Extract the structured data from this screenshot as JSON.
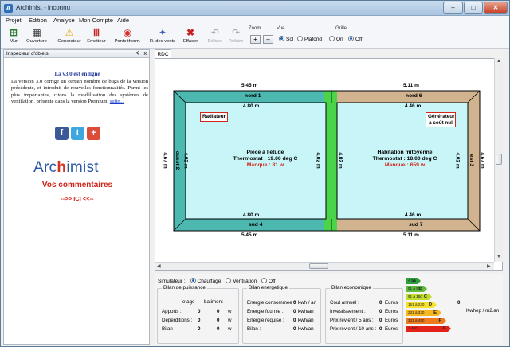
{
  "window": {
    "title": "Archimist - inconnu",
    "controls": {
      "minimize": "–",
      "maximize": "□",
      "close": "✕"
    }
  },
  "menu": [
    "Projet",
    "Edition",
    "Analyse",
    "Mon Compte",
    "Aide"
  ],
  "toolbar": {
    "buttons": [
      {
        "label": "Mur",
        "icon": "plus-wall-icon"
      },
      {
        "label": "Ouverture",
        "icon": "window-icon"
      },
      {
        "label": "Generateur",
        "icon": "warning-triangle-icon"
      },
      {
        "label": "Emetteur",
        "icon": "radiator-icon"
      },
      {
        "label": "Ponts therm.",
        "icon": "target-icon"
      },
      {
        "label": "R. des vents",
        "icon": "compass-star-icon"
      },
      {
        "label": "Effacer",
        "icon": "delete-x-icon"
      },
      {
        "label": "Défaire",
        "icon": "undo-icon"
      },
      {
        "label": "Refaire",
        "icon": "redo-icon"
      }
    ],
    "zoom_label": "Zoom",
    "zoom_plus": "+",
    "zoom_minus": "–",
    "vue_label": "Vue",
    "vue_options": [
      "Sol",
      "Plafond"
    ],
    "vue_selected": "Sol",
    "grille_label": "Grille",
    "grille_options": [
      "On",
      "Off"
    ],
    "grille_selected": "Off"
  },
  "inspector": {
    "title": "Inspecteur d'objets",
    "pin": "ᗕ",
    "close": "x",
    "news_title": "La v3.0 est en ligne",
    "news_body": "La version 3.0 corrige un certain nombre de bugs de la version précédente, et introduit de nouvelles fonctionnalités. Parmi les plus importantes, citons la modélisation des systèmes de ventilation, présente dans la version Premium.",
    "news_link": "suite...",
    "social": [
      {
        "icon": "facebook-icon",
        "glyph": "f",
        "color": "#3b5998"
      },
      {
        "icon": "twitter-icon",
        "glyph": "t",
        "color": "#3fa7e0"
      },
      {
        "icon": "google-plus-icon",
        "glyph": "+",
        "color": "#dd4b39"
      }
    ],
    "logo_left": "Arc",
    "logo_mid": "h",
    "logo_right": "imist",
    "comment_title": "Vos commentaires",
    "comment_link": "-->> ICI <<--"
  },
  "tab": "RDC",
  "plan": {
    "room1": {
      "name": "Pièce à l'étude",
      "thermostat": "Thermostat  : 19.00 deg C",
      "manque": "Manque      : 81 w",
      "wall_north": "nord 1",
      "wall_south": "sud 4",
      "wall_west": "ouest 2",
      "dim_top": "5.45 m",
      "dim_inner_top": "4.80 m",
      "dim_inner_bottom": "4.80 m",
      "dim_bottom": "5.45 m",
      "dim_left_outer": "4.67 m",
      "dim_left_inner": "4.02 m",
      "dim_right_inner": "4.02 m",
      "tag": "Radiateur"
    },
    "room2": {
      "name": "Habitation mitoyenne",
      "thermostat": "Thermostat  : 18.00 deg C",
      "manque": "Manque      : 659 w",
      "wall_north": "nord 6",
      "wall_south": "sud 7",
      "wall_east": "est 3",
      "dim_top": "5.11 m",
      "dim_inner_top": "4.46 m",
      "dim_inner_bottom": "4.46 m",
      "dim_bottom": "5.11 m",
      "dim_left_inner": "4.02 m",
      "dim_right_inner": "4.02 m",
      "dim_right_outer": "4.67 m",
      "tag": "Générateur à coût nul"
    }
  },
  "simulateur": {
    "label": "Simulateur :",
    "options": [
      "Chauffage",
      "Ventilation",
      "Off"
    ],
    "selected": "Chauffage"
  },
  "bilan_puissance": {
    "title": "Bilan de puissance",
    "col1": "etage",
    "col2": "batiment",
    "rows": [
      {
        "label": "Apports :",
        "v1": "0",
        "v2": "0",
        "unit": "w"
      },
      {
        "label": "Deperditions :",
        "v1": "0",
        "v2": "0",
        "unit": "w"
      },
      {
        "label": "Bilan :",
        "v1": "0",
        "v2": "0",
        "unit": "w"
      }
    ]
  },
  "bilan_energetique": {
    "title": "Bilan energetique",
    "rows": [
      {
        "label": "Energie consommee :",
        "v": "0",
        "unit": "kwh / an"
      },
      {
        "label": "Energie fournie :",
        "v": "0",
        "unit": "kwh/an"
      },
      {
        "label": "Energie requise :",
        "v": "0",
        "unit": "kwh/an"
      },
      {
        "label": "Bilan :",
        "v": "0",
        "unit": "kwh/an"
      }
    ]
  },
  "bilan_economique": {
    "title": "Bilan economique",
    "rows": [
      {
        "label": "Cout annuel :",
        "v": "0",
        "unit": "Euros"
      },
      {
        "label": "Investissement :",
        "v": "0",
        "unit": "Euros"
      },
      {
        "label": "Prix revient / 5 ans :",
        "v": "0",
        "unit": "Euros"
      },
      {
        "label": "Prix revient / 10 ans :",
        "v": "0",
        "unit": "Euros"
      }
    ]
  },
  "energy_label": {
    "value": "0",
    "unit": "Kwhep / m2.an",
    "bars": [
      {
        "range": "< 50",
        "letter": "A",
        "color": "#2f9e3a"
      },
      {
        "range": "51 à 90",
        "letter": "B",
        "color": "#5dba3b"
      },
      {
        "range": "91 à 150",
        "letter": "C",
        "color": "#bfdc2f"
      },
      {
        "range": "151 à 230",
        "letter": "D",
        "color": "#f4e22c"
      },
      {
        "range": "231 à 330",
        "letter": "E",
        "color": "#f6b820"
      },
      {
        "range": "331 à 450",
        "letter": "F",
        "color": "#ef7a1e"
      },
      {
        "range": "> 450",
        "letter": "G",
        "color": "#e32119"
      }
    ]
  }
}
